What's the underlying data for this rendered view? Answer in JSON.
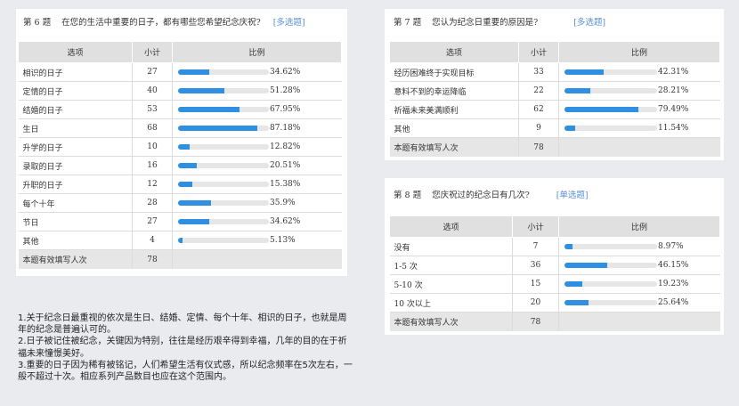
{
  "q6": {
    "number": "第 6 题",
    "title": "在您的生活中重要的日子，都有哪些您希望纪念庆祝?",
    "type": "[多选题]",
    "headers": [
      "选项",
      "小计",
      "比例"
    ],
    "rows": [
      {
        "label": "相识的日子",
        "count": "27",
        "pct_text": "34.62%",
        "pct": 34.62
      },
      {
        "label": "定情的日子",
        "count": "40",
        "pct_text": "51.28%",
        "pct": 51.28
      },
      {
        "label": "结婚的日子",
        "count": "53",
        "pct_text": "67.95%",
        "pct": 67.95
      },
      {
        "label": "生日",
        "count": "68",
        "pct_text": "87.18%",
        "pct": 87.18
      },
      {
        "label": "升学的日子",
        "count": "10",
        "pct_text": "12.82%",
        "pct": 12.82
      },
      {
        "label": "录取的日子",
        "count": "16",
        "pct_text": "20.51%",
        "pct": 20.51
      },
      {
        "label": "升职的日子",
        "count": "12",
        "pct_text": "15.38%",
        "pct": 15.38
      },
      {
        "label": "每个十年",
        "count": "28",
        "pct_text": "35.9%",
        "pct": 35.9
      },
      {
        "label": "节日",
        "count": "27",
        "pct_text": "34.62%",
        "pct": 34.62
      },
      {
        "label": "其他",
        "count": "4",
        "pct_text": "5.13%",
        "pct": 5.13
      }
    ],
    "total_label": "本题有效填写人次",
    "total_count": "78"
  },
  "q7": {
    "number": "第 7 题",
    "title": "您认为纪念日重要的原因是?",
    "type": "[多选题]",
    "headers": [
      "选项",
      "小计",
      "比例"
    ],
    "rows": [
      {
        "label": "经历困难终于实现目标",
        "count": "33",
        "pct_text": "42.31%",
        "pct": 42.31
      },
      {
        "label": "意料不到的幸运降临",
        "count": "22",
        "pct_text": "28.21%",
        "pct": 28.21
      },
      {
        "label": "祈福未来美满顺利",
        "count": "62",
        "pct_text": "79.49%",
        "pct": 79.49
      },
      {
        "label": "其他",
        "count": "9",
        "pct_text": "11.54%",
        "pct": 11.54
      }
    ],
    "total_label": "本题有效填写人次",
    "total_count": "78"
  },
  "q8": {
    "number": "第 8 题",
    "title": "您庆祝过的纪念日有几次?",
    "type": "[单选题]",
    "headers": [
      "选项",
      "小计",
      "比例"
    ],
    "rows": [
      {
        "label": "没有",
        "count": "7",
        "pct_text": "8.97%",
        "pct": 8.97
      },
      {
        "label": "1-5 次",
        "count": "36",
        "pct_text": "46.15%",
        "pct": 46.15
      },
      {
        "label": "5-10 次",
        "count": "15",
        "pct_text": "19.23%",
        "pct": 19.23
      },
      {
        "label": "10 次以上",
        "count": "20",
        "pct_text": "25.64%",
        "pct": 25.64
      }
    ],
    "total_label": "本题有效填写人次",
    "total_count": "78"
  },
  "notes": [
    "1.关于纪念日最重视的依次是生日、结婚、定情、每个十年、相识的日子，也就是周年的纪念是普遍认可的。",
    "2.日子被记住被纪念，关键因为特别，往往是经历艰辛得到幸福，几年的目的在于祈福未来憧憬美好。",
    "3.重要的日子因为稀有被铭记，人们希望生活有仪式感，所以纪念频率在5次左右，一般不超过十次。相应系列产品数目也应在这个范围内。"
  ],
  "colors": {
    "bar_fill": "#2f8fe0",
    "bar_track": "#e6e6e6",
    "header_bg": "#e0e0e0",
    "question_type": "#5a8fd8",
    "background": "#e9ebef"
  }
}
